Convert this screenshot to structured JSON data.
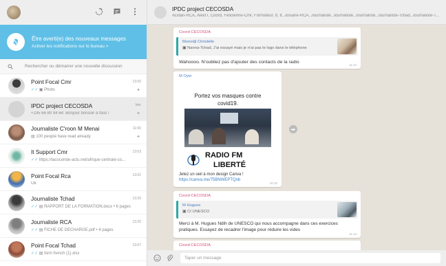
{
  "header": {
    "icons": [
      "status-icon",
      "new-chat-icon",
      "menu-icon"
    ]
  },
  "notification": {
    "title": "Être averti(e) des nouveaux messages",
    "subtitle": "Activer les notifications sur le bureau >"
  },
  "search": {
    "placeholder": "Rechercher ou démarrer une nouvelle discussion"
  },
  "chats": [
    {
      "name": "Point Focal Cmr",
      "preview": "Photo",
      "time": "13:50",
      "pinned": true
    },
    {
      "name": "IPDC project CECOSDA",
      "preview": "+235 66 80 94 64: Bonjour bonsoir à tous !",
      "time": "hier",
      "pinned": true
    },
    {
      "name": "Journaliste C'roon M Menai",
      "preview": "100 people have read already",
      "time": "11:00",
      "pinned": true
    },
    {
      "name": "It Support Cmr",
      "preview": "https://lacoconde-actu.net/afrique-centrale-co...",
      "time": "13:03"
    },
    {
      "name": "Point Focal Rca",
      "preview": "Ok",
      "time": "13:01"
    },
    {
      "name": "Journaliste Tchad",
      "preview": "RAPPORT DE LA FORMATION.docx • 6 pages",
      "time": "13:20"
    },
    {
      "name": "Journaliste RCA",
      "preview": "FICHE DE DECHARGE.pdf • 4 pages",
      "time": "13:20"
    },
    {
      "name": "Point Focal Tchad",
      "preview": "form french (1).xlsx",
      "time": "13:07"
    }
  ],
  "group": {
    "name": "IPDC project CECOSDA",
    "members": "ADdan-RCA, AlexIT, Coord, Felicienne-Cmr, Formateur, It, It, Josiane-RCA, Journaliste, Journaliste, Journaliste, Journaliste-Tchad, Journaliste-T..."
  },
  "messages": {
    "m1": {
      "sender": "Coord CECOSDA",
      "quote_name": "Monodji Christelle",
      "quote_text": "Nanna-Tchad, J'ai essayé mais je n'ai pas le logo dans le téléphone",
      "text": "Wahoooo. N'oubliez pas d'ajouter des contacts de la radio",
      "time": "11:12"
    },
    "m2": {
      "sender": "M Oyio",
      "poster_title": "Portez vos masques contre covid19.",
      "poster_radio_1": "RADIO FM",
      "poster_radio_2": "LIBERTÉ",
      "text": "Jetez un oeil à mon design Canva !",
      "link": "https://canva.me/75BNWEPTQnb",
      "time": "10:15"
    },
    "m3": {
      "sender": "Coord CECOSDA",
      "quote_name": "M Hugues",
      "quote_text": "CI UNESCO",
      "text": "Merci à M. Hugues Ndih de UNESCO qui nous accompagne dans ces exercices pratiques. Essayez de recadrer l'image pour réduire les vides",
      "time": "11:13"
    },
    "m4": {
      "sender": "Coord CECOSDA"
    }
  },
  "composer": {
    "placeholder": "Taper un message"
  },
  "colors": {
    "accent": "#5fbfe6",
    "chat_bg": "#e6e1d9",
    "sender_pink": "#d14d7a",
    "sender_blue": "#4a7ec9"
  }
}
